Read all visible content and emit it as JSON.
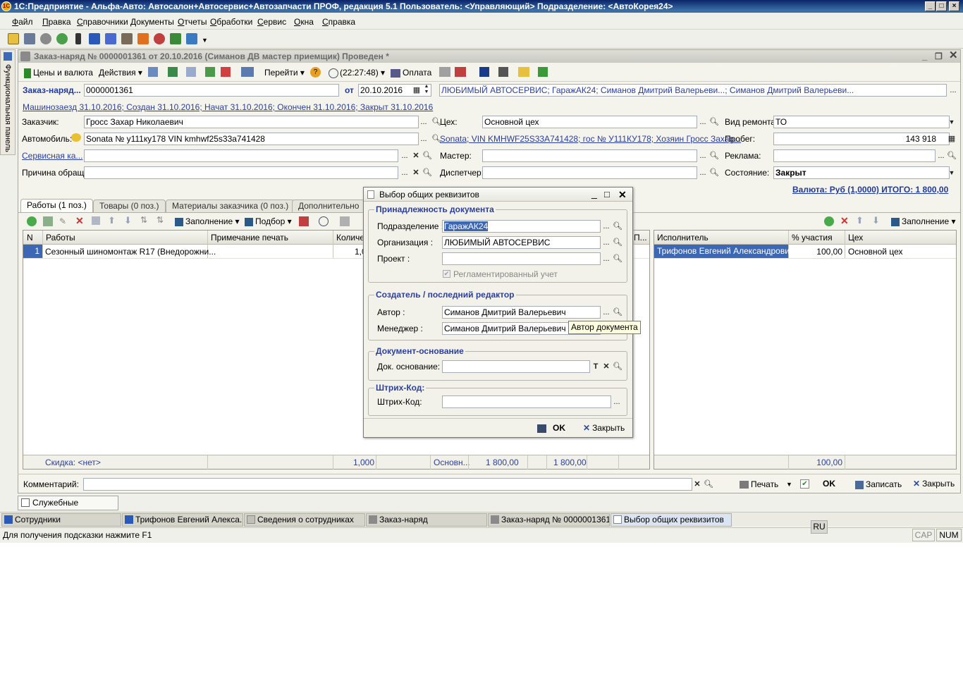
{
  "window": {
    "title": "1С:Предприятие - Альфа-Авто: Автосалон+Автосервис+Автозапчасти ПРОФ, редакция 5.1    Пользователь: <Управляющий>    Подразделение: <АвтоКорея24>",
    "logo_text": "1C"
  },
  "menu": [
    "Файл",
    "Правка",
    "Справочники",
    "Документы",
    "Отчеты",
    "Обработки",
    "Сервис",
    "Окна",
    "Справка"
  ],
  "side_panel": {
    "label": "Функциональная панель"
  },
  "document": {
    "title": "Заказ-наряд № 0000001361 от 20.10.2016 (Симанов ДВ мастер приемщик) Проведен *",
    "toolbar": {
      "prices": "Цены и валюта",
      "actions": "Действия",
      "goto": "Перейти",
      "time": "(22:27:48)",
      "payment": "Оплата"
    },
    "header": {
      "order_label": "Заказ-наряд...",
      "order_number": "0000001361",
      "date_label": "от",
      "date": "20.10.2016",
      "org_info": "ЛЮБИМЫЙ АВТОСЕРВИС; ГаражАК24; Симанов Дмитрий Валерьеви...; Симанов Дмитрий Валерьеви...",
      "dates_link": "Машинозаезд 31.10.2016; Создан 31.10.2016; Начат 31.10.2016; Окончен 31.10.2016; Закрыт 31.10.2016"
    },
    "fields": {
      "customer_label": "Заказчик:",
      "customer": "Гросс Захар Николаевич",
      "car_label": "Автомобиль:",
      "car": "Sonata № у111ку178 VIN kmhwf25s33a741428",
      "service_card_label": "Сервисная ка...",
      "service_card": "",
      "reason_label": "Причина обращ...",
      "reason": "",
      "shop_label": "Цех:",
      "shop": "Основной цех",
      "car_link": "Sonata; VIN KMHWF25S33A741428; гос № У111КУ178; Хозяин Гросс Захар...",
      "master_label": "Мастер:",
      "master": "",
      "dispatcher_label": "Диспетчер:",
      "dispatcher": "",
      "repair_type_label": "Вид ремонта:",
      "repair_type": "ТО",
      "mileage_label": "Пробег:",
      "mileage": "143 918",
      "ads_label": "Реклама:",
      "ads": "",
      "state_label": "Состояние:",
      "state": "Закрыт",
      "total_link": "Валюта: Руб (1,0000) ИТОГО: 1 800,00"
    },
    "tabs": [
      "Работы (1 поз.)",
      "Товары (0 поз.)",
      "Материалы заказчика (0 поз.)",
      "Дополнительно"
    ],
    "works_toolbar": {
      "fill": "Заполнение",
      "select": "Подбор"
    },
    "works_table": {
      "columns": [
        "N",
        "Работы",
        "Примечание печать",
        "Количе...",
        "П..."
      ],
      "rows": [
        {
          "n": "1",
          "work": "Сезонный шиномонтаж R17 (Внедорожни...",
          "note": "",
          "qty": "1,0"
        }
      ],
      "footer": {
        "discount": "Скидка: <нет>",
        "qty": "1,000",
        "shop": "Основн...",
        "sum1": "1 800,00",
        "sum2": "1 800,00"
      }
    },
    "executors_toolbar": {
      "fill": "Заполнение"
    },
    "executors_table": {
      "columns": [
        "Исполнитель",
        "% участия",
        "Цех"
      ],
      "rows": [
        {
          "name": "Трифонов Евгений Александрович",
          "pct": "100,00",
          "shop": "Основной цех"
        }
      ],
      "footer": {
        "pct": "100,00"
      }
    },
    "bottom": {
      "comment_label": "Комментарий:",
      "comment": "",
      "print": "Печать",
      "ok": "OK",
      "save": "Записать",
      "close": "Закрыть"
    }
  },
  "dialog": {
    "title": "Выбор общих реквизитов",
    "group1": {
      "title": "Принадлежность документа",
      "subdiv_label": "Подразделение :",
      "subdiv": "ГаражАК24",
      "org_label": "Организация :",
      "org": "ЛЮБИМЫЙ АВТОСЕРВИС",
      "project_label": "Проект :",
      "project": "",
      "reg_label": "Регламентированный учет"
    },
    "group2": {
      "title": "Создатель / последний редактор",
      "author_label": "Автор :",
      "author": "Симанов Дмитрий Валерьевич",
      "manager_label": "Менеджер :",
      "manager": "Симанов Дмитрий Валерьевич",
      "tooltip": "Автор документа"
    },
    "group3": {
      "title": "Документ-основание",
      "base_label": "Док. основание:",
      "base": ""
    },
    "group4": {
      "title": "Штрих-Код:",
      "barcode_label": "Штрих-Код:",
      "barcode": ""
    },
    "ok": "OK",
    "close": "Закрыть"
  },
  "service_messages": "Служебные сообщения",
  "taskbar": [
    "Сотрудники",
    "Трифонов Евгений Алекса...",
    "Сведения о сотрудниках",
    "Заказ-наряд",
    "Заказ-наряд № 0000001361...",
    "Выбор общих реквизитов"
  ],
  "status": {
    "hint": "Для получения подсказки нажмите F1",
    "lang": "RU",
    "cap": "CAP",
    "num": "NUM"
  },
  "colors": {
    "title_bar": "#0a246a",
    "link": "#2b3fa0",
    "selection": "#3c67b5"
  }
}
